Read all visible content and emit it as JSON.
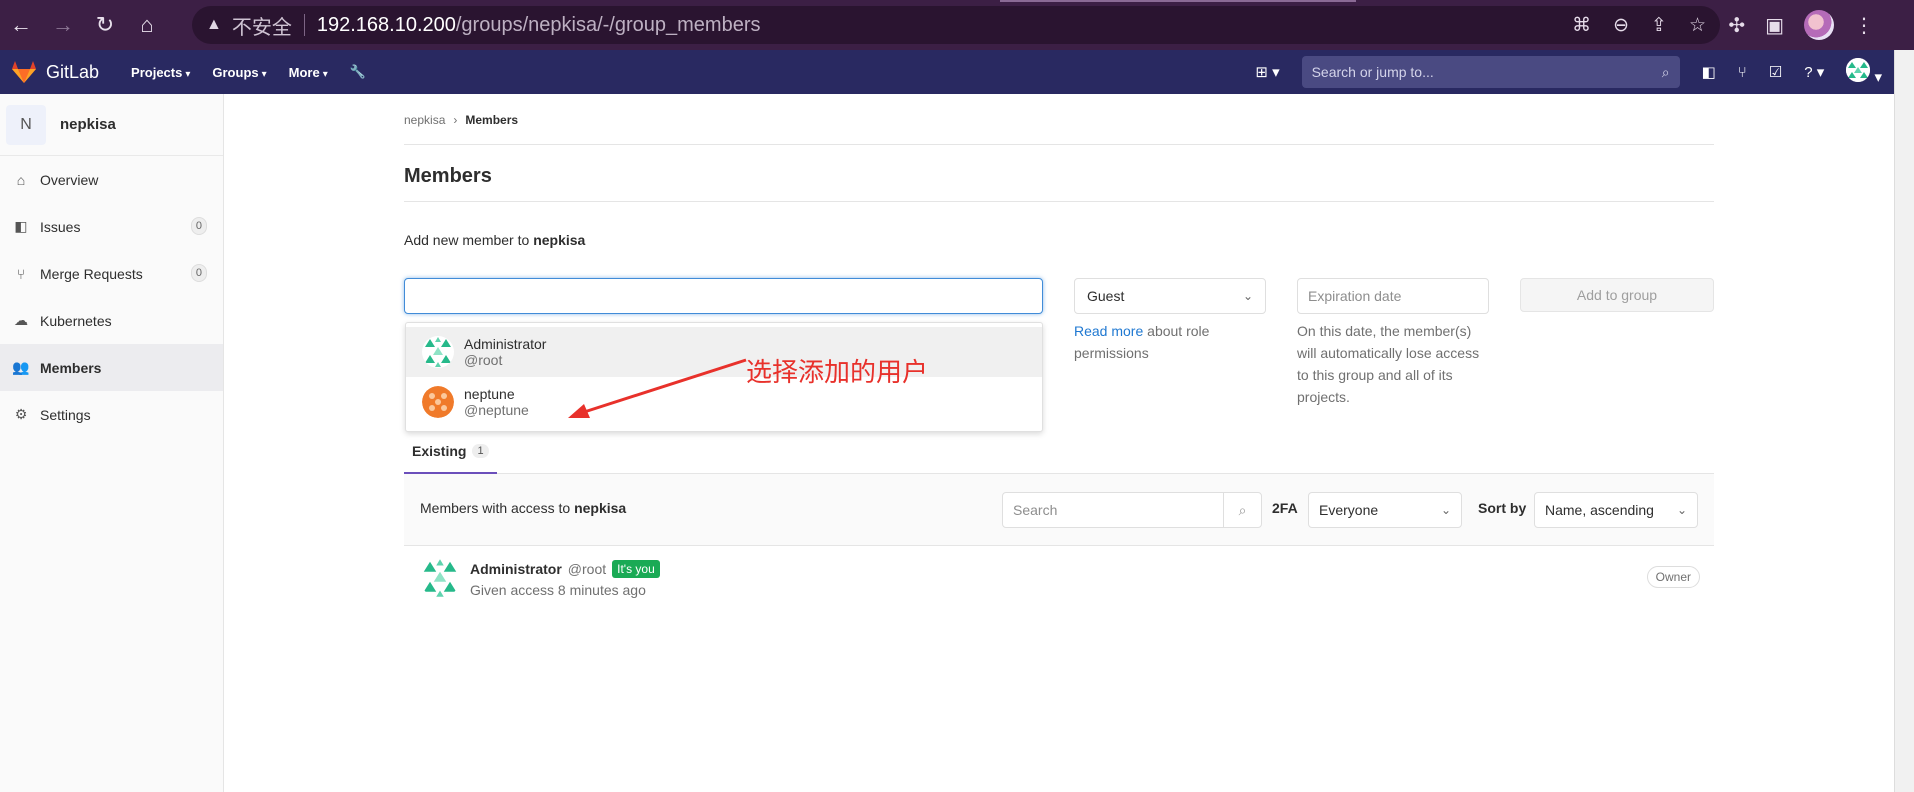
{
  "browser": {
    "insecure_label": "不安全",
    "url_host": "192.168.10.200",
    "url_path": "/groups/nepkisa/-/group_members"
  },
  "header": {
    "logo_text": "GitLab",
    "menu": [
      "Projects",
      "Groups",
      "More"
    ],
    "search_placeholder": "Search or jump to..."
  },
  "sidebar": {
    "group_initial": "N",
    "group_name": "nepkisa",
    "items": [
      {
        "label": "Overview",
        "icon": "home-icon"
      },
      {
        "label": "Issues",
        "icon": "issues-icon",
        "count": "0"
      },
      {
        "label": "Merge Requests",
        "icon": "merge-request-icon",
        "count": "0"
      },
      {
        "label": "Kubernetes",
        "icon": "cloud-icon"
      },
      {
        "label": "Members",
        "icon": "users-icon",
        "active": true
      },
      {
        "label": "Settings",
        "icon": "settings-icon"
      }
    ]
  },
  "breadcrumb": {
    "group": "nepkisa",
    "separator": "›",
    "current": "Members"
  },
  "page": {
    "title": "Members",
    "add_member_prefix": "Add new member to",
    "add_member_group": "nepkisa"
  },
  "form": {
    "member_input_value": "",
    "dropdown": [
      {
        "name": "Administrator",
        "username": "@root"
      },
      {
        "name": "neptune",
        "username": "@neptune"
      }
    ],
    "role_value": "Guest",
    "role_help_link": "Read more",
    "role_help_text": "about role permissions",
    "expiration_placeholder": "Expiration date",
    "expiration_help": "On this date, the member(s) will automatically lose access to this group and all of its projects.",
    "add_button": "Add to group"
  },
  "tabs": {
    "existing_label": "Existing",
    "existing_count": "1"
  },
  "members_panel": {
    "title_prefix": "Members with access to",
    "title_group": "nepkisa",
    "search_placeholder": "Search",
    "twofa_label": "2FA",
    "twofa_value": "Everyone",
    "sort_label": "Sort by",
    "sort_value": "Name, ascending"
  },
  "member_row": {
    "name": "Administrator",
    "username": "@root",
    "badge": "It's you",
    "access": "Given access 8 minutes ago",
    "role": "Owner"
  },
  "annotation": {
    "text": "选择添加的用户",
    "color": "#e8312b"
  }
}
